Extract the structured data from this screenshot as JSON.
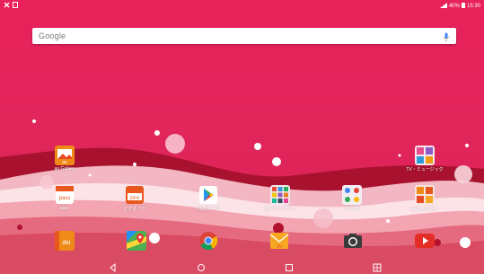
{
  "status_bar": {
    "right_text": "40%",
    "time": "15:30"
  },
  "search": {
    "logo": "Google"
  },
  "apps": [
    {
      "label": "au Gallery",
      "icon": "au-gallery-icon"
    },
    {
      "label": "TV・ミュージック",
      "icon": "tv-music-folder-icon"
    },
    {
      "label": "pass",
      "icon": "au-pass-icon"
    },
    {
      "label": "ビデオパス",
      "icon": "video-pass-icon"
    },
    {
      "label": "Playストア",
      "icon": "play-store-icon"
    },
    {
      "label": "ユーティリティ",
      "icon": "utility-folder-icon"
    },
    {
      "label": "Google",
      "icon": "google-folder-icon"
    },
    {
      "label": "auフォルダー",
      "icon": "au-folder-icon"
    }
  ],
  "dock": [
    {
      "icon": "au-app-icon"
    },
    {
      "icon": "maps-icon"
    },
    {
      "icon": "chrome-icon"
    },
    {
      "icon": "email-icon"
    },
    {
      "icon": "camera-icon"
    },
    {
      "icon": "youtube-icon"
    }
  ],
  "colors": {
    "wallpaper": "#e2265c",
    "wave_dark": "#a8122f",
    "wave_light": "#f4b8c2"
  }
}
